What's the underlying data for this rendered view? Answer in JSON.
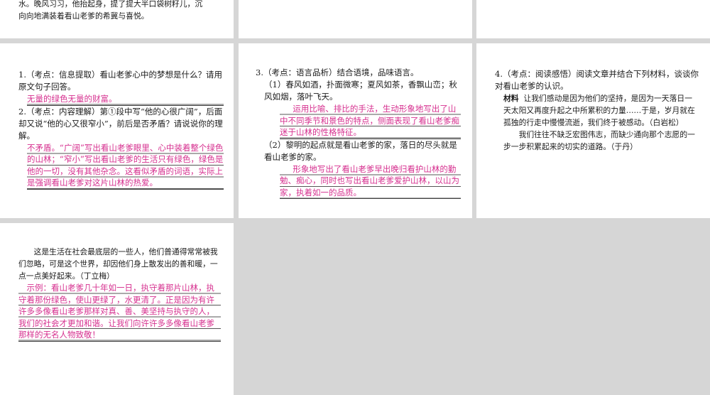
{
  "top": {
    "left_line1": "水。晚风习习，他抬起身，提了提大半口袋树籽儿，沉",
    "left_line2": "向向地满装着看山老爹的希冀与喜悦。"
  },
  "q1": {
    "question": "1.（考点：信息提取）看山老爹心中的梦想是什么？请用原文句子回答。",
    "answer": "无量的绿色无量的财富。"
  },
  "q2": {
    "question": "2.（考点：内容理解）第①段中写“他的心很广阔”，后面却又说“他的心又很窄小”，前后是否矛盾？请说说你的理解。",
    "answer": "不矛盾。“广阔”写出看山老爹眼里、心中装着整个绿色的山林；“窄小”写出看山老爹的生活只有绿色，绿色是他的一切，没有其他杂念。这看似矛盾的词语，实际上是强调看山老爹对这片山林的热爱。"
  },
  "q3": {
    "question": "3.（考点：语言品析）结合语境，品味语言。",
    "sub1": "（1）春风如酒，扑面微寒；夏风如茶，香飘山峦；秋风如烟，落叶飞天。",
    "answer1": "运用比喻、排比的手法，生动形象地写出了山中不同季节和景色的特点，侧面表现了看山老爹痴迷于山林的性格特征。",
    "sub2": "（2）黎明的起点就是看山老爹的家，落日的尽头就是看山老爹的家。",
    "answer2": "形象地写出了看山老爹早出晚归看护山林的勤勉、痴心，同时也写出看山老爹爱护山林，以山为家，执着如一的品质。"
  },
  "q4": {
    "question": "4.（考点：阅读感悟）阅读文章并结合下列材料，谈谈你对看山老爹的认识。",
    "material_label": "材料",
    "material_text": "让我们感动是因为他们的坚持，是因为一天落日一天太阳又再度升起之中所累积的力量……于是，岁月就在孤独的行走中慢慢流逝，我们终于被感动。（白岩松）",
    "material_text2": "我们往往不缺乏宏图伟志，而缺少通向那个志愿的一步一步积累起来的切实的道路。（于丹）"
  },
  "q4_cont": {
    "text": "这是生活在社会最底层的一些人，他们普通得常常被我们忽略，可是这个世界，却因他们身上散发出的善和暖，一点一点美好起来。（丁立梅）",
    "answer": "示例：看山老爹几十年如一日，执守着那片山林，执守着那份绿色，使山更绿了，水更清了。正是因为有许许多多像看山老爹那样对真、善、美坚持与执守的人，我们的社会才更加和谐。让我们向许许多多像看山老爹那样的无名人物致敬！"
  }
}
